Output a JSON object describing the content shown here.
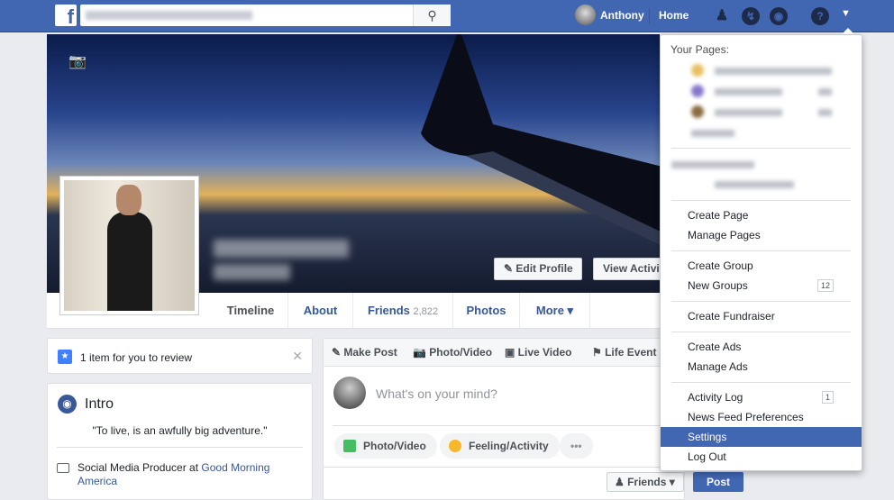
{
  "topbar": {
    "logo": "f",
    "search_value": "",
    "user": "Anthony",
    "home": "Home",
    "icons": [
      "friends-icon",
      "messenger-icon",
      "globe-icon",
      "help-icon",
      "caret-down-icon"
    ]
  },
  "profile": {
    "edit_profile": "Edit Profile",
    "view_activity": "View Activity Log"
  },
  "tabs": [
    {
      "label": "Timeline"
    },
    {
      "label": "About"
    },
    {
      "label": "Friends",
      "count": "2,822"
    },
    {
      "label": "Photos"
    },
    {
      "label": "More ▾"
    }
  ],
  "review": {
    "text": "1 item for you to review"
  },
  "intro": {
    "title": "Intro",
    "quote": "\"To live, is an awfully big adventure.\"",
    "job_prefix": "Social Media Producer at ",
    "job_link": "Good Morning America"
  },
  "composer": {
    "tabs": [
      "Make Post",
      "Photo/Video",
      "Live Video",
      "Life Event"
    ],
    "placeholder": "What's on your mind?",
    "actions": [
      "Photo/Video",
      "Feeling/Activity",
      "•••"
    ],
    "audience": "Friends ▾",
    "post": "Post"
  },
  "menu": {
    "header": "Your Pages:",
    "groups": [
      [
        {
          "label": "Create Page"
        },
        {
          "label": "Manage Pages"
        }
      ],
      [
        {
          "label": "Create Group"
        },
        {
          "label": "New Groups",
          "badge": "12"
        }
      ],
      [
        {
          "label": "Create Fundraiser"
        }
      ],
      [
        {
          "label": "Create Ads"
        },
        {
          "label": "Manage Ads"
        }
      ],
      [
        {
          "label": "Activity Log",
          "badge": "1"
        },
        {
          "label": "News Feed Preferences"
        },
        {
          "label": "Settings",
          "selected": true
        },
        {
          "label": "Log Out"
        }
      ]
    ]
  },
  "colors": {
    "brand": "#4267b2",
    "link": "#365899"
  }
}
